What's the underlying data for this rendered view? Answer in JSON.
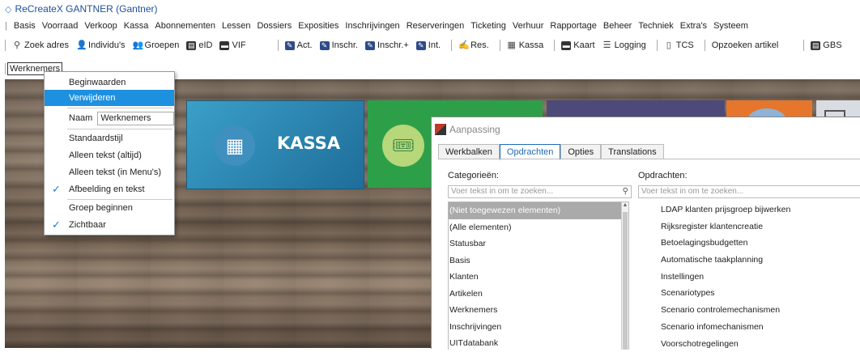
{
  "app_title": "ReCreateX GANTNER  (Gantner)",
  "menu": [
    "Basis",
    "Voorraad",
    "Verkoop",
    "Kassa",
    "Abonnementen",
    "Lessen",
    "Dossiers",
    "Exposities",
    "Inschrijvingen",
    "Reserveringen",
    "Ticketing",
    "Verhuur",
    "Rapportage",
    "Beheer",
    "Techniek",
    "Extra's",
    "Systeem"
  ],
  "toolbar": {
    "zoek_adres": "Zoek adres",
    "individus": "Individu's",
    "groepen": "Groepen",
    "eid": "eID",
    "vif": "VIF",
    "act": "Act.",
    "inschr": "Inschr.",
    "inschr_plus": "Inschr.+",
    "int": "Int.",
    "res": "Res.",
    "kassa": "Kassa",
    "kaart": "Kaart",
    "logging": "Logging",
    "tcs": "TCS",
    "opzoeken": "Opzoeken artikel",
    "gbs": "GBS"
  },
  "werknemers_button": "Werknemers",
  "tiles": {
    "kassa": "KASSA"
  },
  "context_menu": {
    "beginwaarden": "Beginwaarden",
    "verwijderen": "Verwijderen",
    "naam_label": "Naam",
    "naam_value": "Werknemers",
    "standaardstijl": "Standaardstijl",
    "alleen_tekst_altijd": "Alleen tekst (altijd)",
    "alleen_tekst_menu": "Alleen tekst (in Menu's)",
    "afbeelding_en_tekst": "Afbeelding en tekst",
    "groep_beginnen": "Groep beginnen",
    "zichtbaar": "Zichtbaar"
  },
  "dialog": {
    "title": "Aanpassing",
    "tabs": [
      "Werkbalken",
      "Opdrachten",
      "Opties",
      "Translations"
    ],
    "active_tab": "Opdrachten",
    "categories_label": "Categorieën:",
    "commands_label": "Opdrachten:",
    "categories_search_placeholder": "Voer tekst in om te zoeken...",
    "commands_search_placeholder": "Voer tekst in om te zoeken...",
    "categories": [
      "(Niet toegewezen elementen)",
      "(Alle elementen)",
      "Statusbar",
      "Basis",
      "Klanten",
      "Artikelen",
      "Werknemers",
      "Inschrijvingen",
      "UITdatabank"
    ],
    "selected_category": "(Niet toegewezen elementen)",
    "commands": [
      "LDAP klanten prijsgroep bijwerken",
      "Rijksregister klantencreatie",
      "Betoelagingsbudgetten",
      "Automatische taakplanning",
      "Instellingen",
      "Scenariotypes",
      "Scenario controlemechanismen",
      "Scenario infomechanismen",
      "Voorschotregelingen"
    ]
  }
}
